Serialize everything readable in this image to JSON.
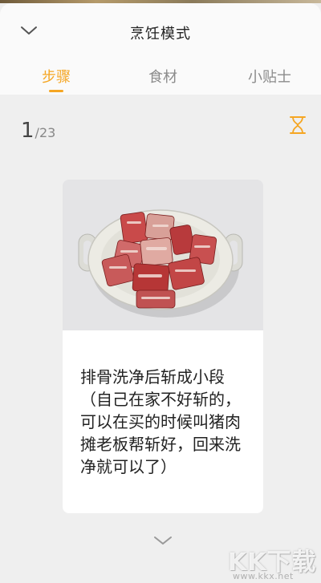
{
  "header": {
    "title": "烹饪模式",
    "back_icon": "chevron-down-icon"
  },
  "tabs": [
    {
      "label": "步骤",
      "active": true
    },
    {
      "label": "食材",
      "active": false
    },
    {
      "label": "小贴士",
      "active": false
    }
  ],
  "step": {
    "current": "1",
    "total": "/23",
    "timer_icon": "hourglass-icon"
  },
  "card": {
    "image_description_icon": "food-photo",
    "text": "排骨洗净后斩成小段（自己在家不好斩的，可以在买的时候叫猪肉摊老板帮斩好，回来洗净就可以了）"
  },
  "next_icon": "chevron-down-icon",
  "watermark": {
    "logo": "KK下载",
    "url": "www.kkx.net"
  },
  "colors": {
    "accent": "#f5a623",
    "background": "#efefef",
    "card": "#ffffff"
  }
}
